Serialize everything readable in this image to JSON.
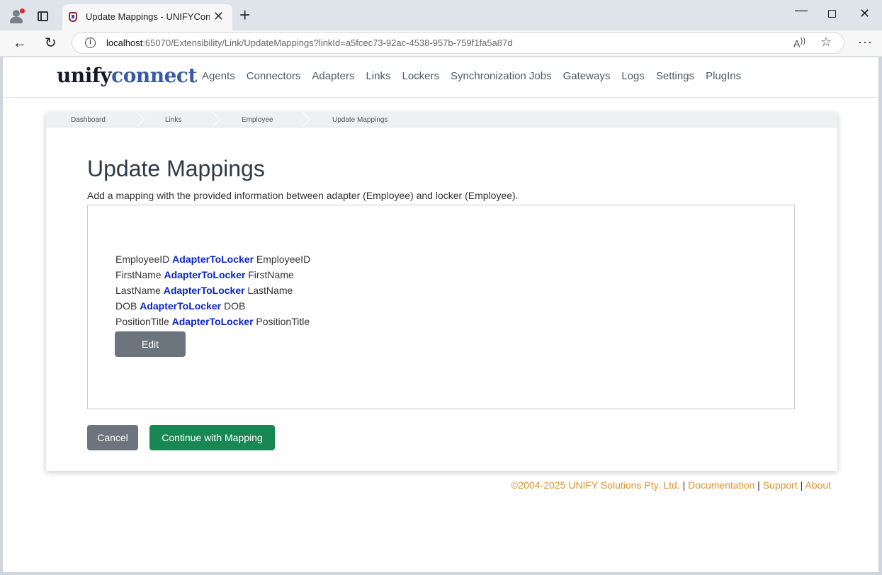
{
  "browser": {
    "tab_title": "Update Mappings - UNIFYConnect",
    "url_host": "localhost",
    "url_rest": ":65070/Extensibility/Link/UpdateMappings?linkId=a5fcec73-92ac-4538-957b-759f1fa5a87d"
  },
  "site": {
    "logo_part1": "unify",
    "logo_part2": "connect",
    "nav": [
      "Agents",
      "Connectors",
      "Adapters",
      "Links",
      "Lockers",
      "Synchronization Jobs",
      "Gateways",
      "Logs",
      "Settings",
      "PlugIns"
    ]
  },
  "breadcrumb": [
    "Dashboard",
    "Links",
    "Employee",
    "Update Mappings"
  ],
  "page": {
    "title": "Update Mappings",
    "description": "Add a mapping with the provided information between adapter (Employee) and locker (Employee).",
    "mappings": [
      {
        "source": "EmployeeID",
        "direction": "AdapterToLocker",
        "target": "EmployeeID"
      },
      {
        "source": "FirstName",
        "direction": "AdapterToLocker",
        "target": "FirstName"
      },
      {
        "source": "LastName",
        "direction": "AdapterToLocker",
        "target": "LastName"
      },
      {
        "source": "DOB",
        "direction": "AdapterToLocker",
        "target": "DOB"
      },
      {
        "source": "PositionTitle",
        "direction": "AdapterToLocker",
        "target": "PositionTitle"
      }
    ],
    "edit_label": "Edit",
    "cancel_label": "Cancel",
    "continue_label": "Continue with Mapping"
  },
  "footer": {
    "copyright": "©2004-2025 UNIFY Solutions Pty. Ltd.",
    "sep": "|",
    "documentation": "Documentation",
    "support": "Support",
    "about": "About"
  },
  "colors": {
    "direction_text": "#0a24c8",
    "continue_button": "#198754",
    "secondary_button": "#6c757d",
    "footer_link": "#e0932a"
  }
}
